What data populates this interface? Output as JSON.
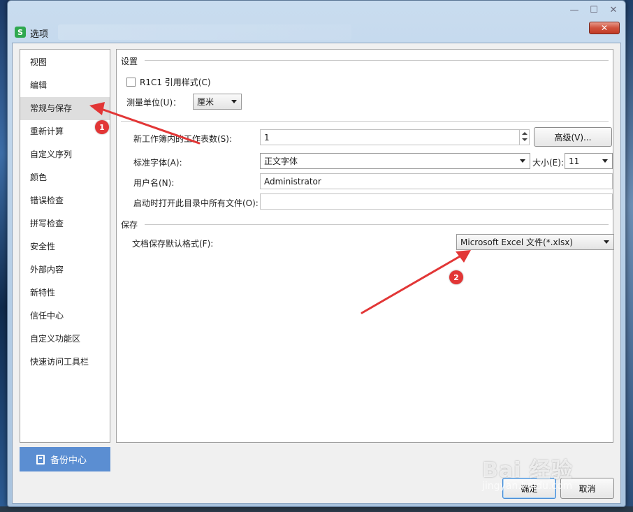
{
  "window": {
    "title": "选项",
    "app_icon": "S",
    "close_label": "✕"
  },
  "sidebar": {
    "items": [
      {
        "label": "视图"
      },
      {
        "label": "编辑"
      },
      {
        "label": "常规与保存",
        "selected": true
      },
      {
        "label": "重新计算"
      },
      {
        "label": "自定义序列"
      },
      {
        "label": "颜色"
      },
      {
        "label": "错误检查"
      },
      {
        "label": "拼写检查"
      },
      {
        "label": "安全性"
      },
      {
        "label": "外部内容"
      },
      {
        "label": "新特性"
      },
      {
        "label": "信任中心"
      },
      {
        "label": "自定义功能区"
      },
      {
        "label": "快速访问工具栏"
      }
    ],
    "backup_label": "备份中心",
    "backup_icon": "backup-icon"
  },
  "settings": {
    "group_label": "设置",
    "r1c1_label": "R1C1 引用样式(C)",
    "r1c1_checked": false,
    "unit_label": "测量单位(U)：",
    "unit_value": "厘米",
    "sheets_label": "新工作簿内的工作表数(S):",
    "sheets_value": "1",
    "advanced_label": "高级(V)...",
    "font_label": "标准字体(A):",
    "font_value": "正文字体",
    "size_label": "大小(E):",
    "size_value": "11",
    "username_label": "用户名(N):",
    "username_value": "Administrator",
    "startup_label": "启动时打开此目录中所有文件(O):",
    "startup_value": ""
  },
  "save": {
    "group_label": "保存",
    "format_label": "文档保存默认格式(F):",
    "format_value": "Microsoft Excel 文件(*.xlsx)"
  },
  "footer": {
    "ok_label": "确定",
    "cancel_label": "取消"
  },
  "annotations": {
    "marker1": "1",
    "marker2": "2",
    "arrow_color": "#e23636",
    "watermark": "Bai 经验",
    "watermark_sub": "jingyan.baidu.com"
  },
  "colors": {
    "backup_button": "#5b8ed2",
    "selected_item": "#dedede"
  }
}
